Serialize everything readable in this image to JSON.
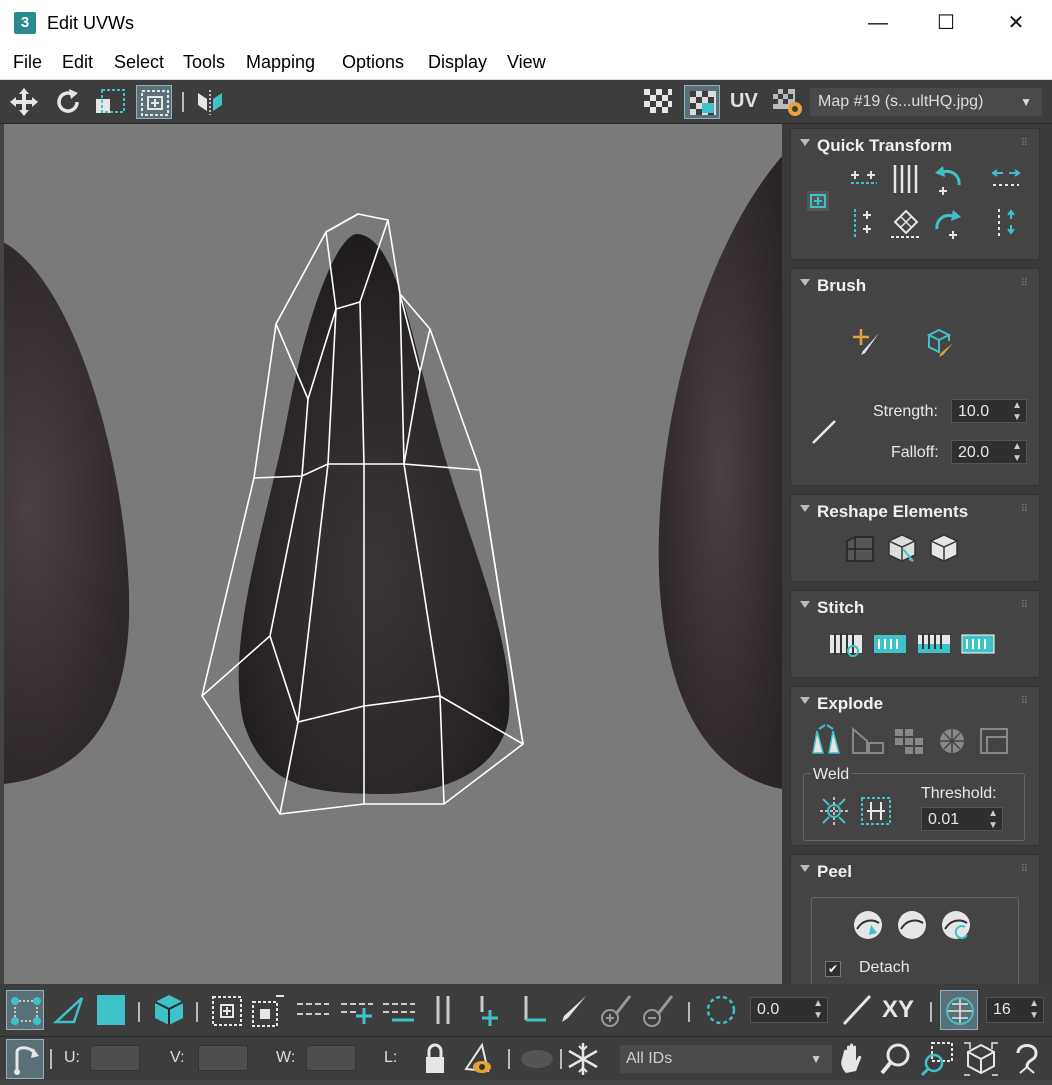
{
  "window": {
    "app_icon_text": "3",
    "title": "Edit UVWs",
    "minimize": "—",
    "maximize": "☐",
    "close": "✕"
  },
  "menu": {
    "items": [
      "File",
      "Edit",
      "Select",
      "Tools",
      "Mapping",
      "Options",
      "Display",
      "View"
    ]
  },
  "toolbar": {
    "uv_label": "UV",
    "map_select_value": "Map #19 (s...ultHQ.jpg)",
    "map_select_arrow": "▼"
  },
  "panel": {
    "quick_transform": {
      "title": "Quick Transform"
    },
    "brush": {
      "title": "Brush",
      "strength_label": "Strength:",
      "strength_value": "10.0",
      "falloff_label": "Falloff:",
      "falloff_value": "20.0"
    },
    "reshape": {
      "title": "Reshape Elements"
    },
    "stitch": {
      "title": "Stitch"
    },
    "explode": {
      "title": "Explode",
      "weld_label": "Weld",
      "threshold_label": "Threshold:",
      "threshold_value": "0.01"
    },
    "peel": {
      "title": "Peel",
      "detach_label": "Detach",
      "detach_checked": true
    }
  },
  "bottom": {
    "rotation_value": "0.0",
    "xy_label": "XY",
    "grid_value": "16",
    "u_label": "U:",
    "v_label": "V:",
    "w_label": "W:",
    "l_label": "L:",
    "ids_select_value": "All IDs"
  },
  "colors": {
    "accent": "#3fc1c9",
    "viewport_bg": "#7a7a7a",
    "panel_bg": "#3a3a3a",
    "toolbar_bg": "#3d3d3d"
  }
}
